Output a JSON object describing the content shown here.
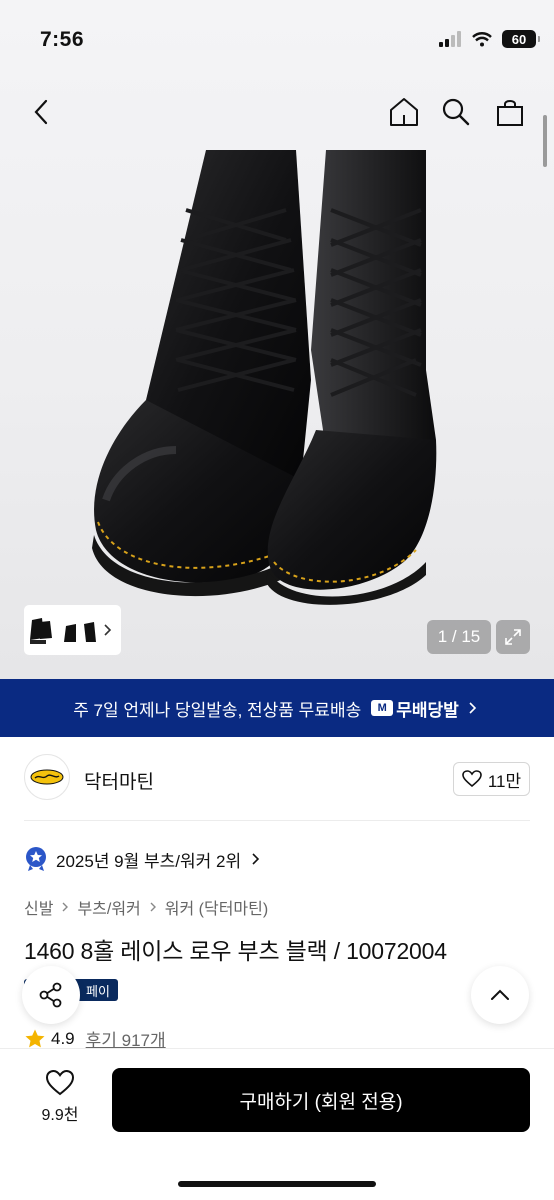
{
  "status": {
    "time": "7:56",
    "battery": "60"
  },
  "gallery": {
    "counter": "1 / 15"
  },
  "delivery": {
    "text": "주 7일 언제나 당일발송, 전상품 무료배송",
    "badge": "무배당발",
    "badge_icon_letter": "M"
  },
  "brand": {
    "name": "닥터마틴",
    "likes": "11만",
    "logo_text": "Dr. Martens"
  },
  "ranking": {
    "text": "2025년 9월 부츠/워커 2위"
  },
  "breadcrumb": [
    "신발",
    "부츠/워커",
    "워커 (닥터마틴)"
  ],
  "product": {
    "title": "1460 8홀 레이스 로우 부츠 블랙 / 10072004",
    "pay_tag": "페이"
  },
  "rating": {
    "score": "4.9",
    "reviews": "후기 917개"
  },
  "bottom": {
    "wish_count": "9.9천",
    "buy_label": "구매하기 (회원 전용)"
  },
  "colors": {
    "banner": "#0a2a82",
    "buy_button": "#000000",
    "star": "#f4b400",
    "rank_badge": "#2b56c8"
  }
}
